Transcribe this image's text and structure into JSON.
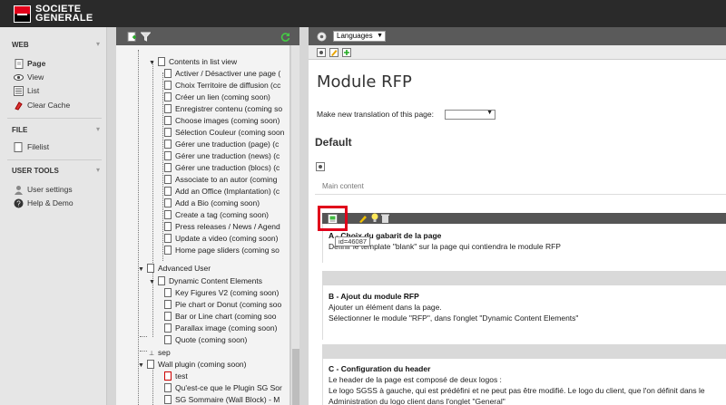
{
  "brand": {
    "line1": "SOCIETE",
    "line2": "GENERALE"
  },
  "leftnav": {
    "web": {
      "heading": "WEB",
      "items": [
        {
          "label": "Page",
          "icon": "page-icon"
        },
        {
          "label": "View",
          "icon": "eye-icon"
        },
        {
          "label": "List",
          "icon": "list-icon"
        },
        {
          "label": "Clear Cache",
          "icon": "clear-cache-icon"
        }
      ]
    },
    "file": {
      "heading": "FILE",
      "items": [
        {
          "label": "Filelist",
          "icon": "filelist-icon"
        }
      ]
    },
    "user_tools": {
      "heading": "USER TOOLS",
      "items": [
        {
          "label": "User settings",
          "icon": "user-settings-icon"
        },
        {
          "label": "Help & Demo",
          "icon": "help-icon"
        }
      ]
    }
  },
  "tree": {
    "items": [
      "Contents in list view",
      "Activer / Désactiver une page (",
      "Choix Territoire de diffusion (cc",
      "Créer un lien (coming soon)",
      "Enregistrer contenu (coming so",
      "Choose images (coming soon)",
      "Sélection Couleur (coming soon",
      "Gérer une traduction (page) (c",
      "Gérer une traduction (news) (c",
      "Gérer une traduction (blocs) (c",
      "Associate to an autor (coming",
      "Add an Office (Implantation) (c",
      "Add a Bio (coming soon)",
      "Create a tag (coming soon)",
      "Press releases / News / Agend",
      "Update a video (coming soon)",
      "Home page sliders (coming so",
      "Advanced User",
      "Dynamic Content Elements",
      "Key Figures V2 (coming soon)",
      "Pie chart or Donut (coming soo",
      "Bar or Line chart (coming soo",
      "Parallax image (coming soon)",
      "Quote (coming soon)",
      "sep",
      "Wall plugin (coming soon)",
      "test",
      "Qu'est-ce que le Plugin SG Sor",
      "SG Sommaire (Wall Block) - M"
    ]
  },
  "toolbar": {
    "languages": "Languages"
  },
  "main": {
    "title": "Module RFP",
    "translate_label": "Make new translation of this page:",
    "section": "Default",
    "column_label": "Main content",
    "tooltip": "id=46087",
    "blocks": [
      {
        "title": "A - Choix du gabarit de la page",
        "lines": [
          "Définir le template \"blank\" sur la page qui contiendra le module RFP"
        ]
      },
      {
        "title": "B - Ajout du module RFP",
        "lines": [
          "Ajouter un élément dans la page.",
          "Sélectionner le module \"RFP\", dans l'onglet \"Dynamic Content Elements\""
        ]
      },
      {
        "title": "C - Configuration du header",
        "lines": [
          "Le header de la page est composé de deux logos :",
          "Le logo SGSS à gauche, qui est prédéfini et ne peut pas être modifié. Le logo du client, que l'on définit dans le",
          "Administration du logo client dans l'onglet \"General\""
        ]
      }
    ]
  }
}
